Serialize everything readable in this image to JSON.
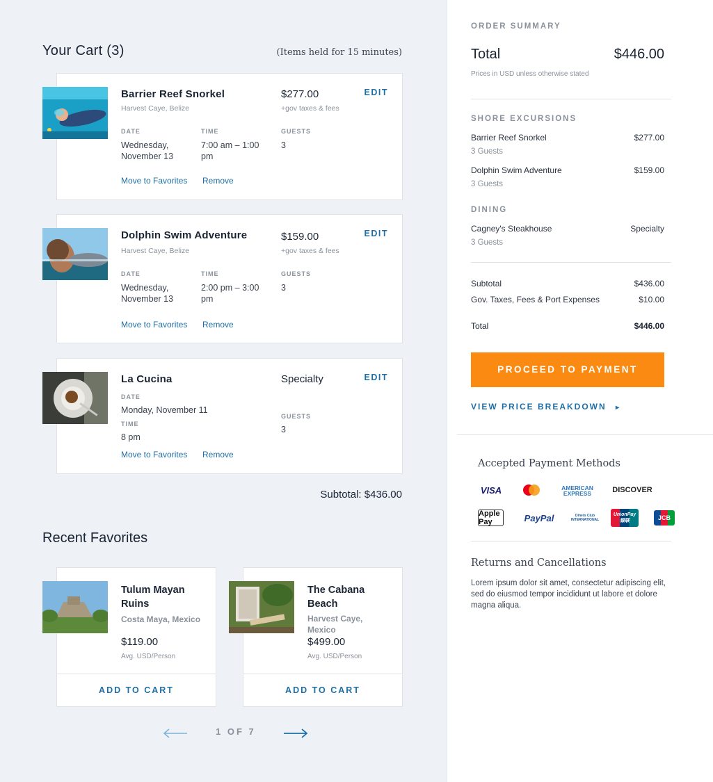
{
  "cart": {
    "title": "Your Cart (3)",
    "held_note": "(Items held for 15 minutes)",
    "edit_label": "EDIT",
    "move_label": "Move to Favorites",
    "remove_label": "Remove",
    "date_label": "DATE",
    "time_label": "TIME",
    "guests_label": "GUESTS",
    "items": [
      {
        "name": "Barrier Reef Snorkel",
        "location": "Harvest Caye, Belize",
        "price": "$277.00",
        "fees": "+gov taxes & fees",
        "date": "Wednesday, November 13",
        "time": "7:00 am – 1:00 pm",
        "guests": "3"
      },
      {
        "name": "Dolphin Swim Adventure",
        "location": "Harvest Caye, Belize",
        "price": "$159.00",
        "fees": "+gov taxes & fees",
        "date": "Wednesday, November 13",
        "time": "2:00 pm – 3:00 pm",
        "guests": "3"
      },
      {
        "name": "La Cucina",
        "price": "Specialty",
        "date": "Monday, November 11",
        "time": "8 pm",
        "guests": "3"
      }
    ],
    "subtotal": "Subtotal: $436.00"
  },
  "favorites": {
    "title": "Recent Favorites",
    "add_label": "ADD TO CART",
    "avg_label": "Avg. USD/Person",
    "items": [
      {
        "name": "Tulum Mayan Ruins",
        "location": "Costa Maya, Mexico",
        "price": "$119.00"
      },
      {
        "name": "The Cabana Beach",
        "location": "Harvest Caye, Mexico",
        "price": "$499.00"
      }
    ],
    "pager": "1 OF 7"
  },
  "summary": {
    "label": "ORDER SUMMARY",
    "total_label": "Total",
    "total_value": "$446.00",
    "note": "Prices in USD unless otherwise stated",
    "shore_label": "SHORE EXCURSIONS",
    "shore": [
      {
        "name": "Barrier Reef Snorkel",
        "value": "$277.00",
        "sub": "3 Guests"
      },
      {
        "name": "Dolphin Swim Adventure",
        "value": "$159.00",
        "sub": "3 Guests"
      }
    ],
    "dining_label": "DINING",
    "dining": [
      {
        "name": "Cagney's Steakhouse",
        "value": "Specialty",
        "sub": "3 Guests"
      }
    ],
    "subtotal_label": "Subtotal",
    "subtotal_value": "$436.00",
    "taxes_label": "Gov. Taxes, Fees & Port Expenses",
    "taxes_value": "$10.00",
    "final_total_label": "Total",
    "final_total_value": "$446.00",
    "proceed_label": "PROCEED TO PAYMENT",
    "breakdown_label": "VIEW PRICE BREAKDOWN",
    "breakdown_arrow": "▸",
    "accepted_label": "Accepted Payment Methods",
    "payments": [
      "VISA",
      "Mastercard",
      "AMERICAN EXPRESS",
      "DISCOVER",
      "Apple Pay",
      "PayPal",
      "Diners Club INTERNATIONAL",
      "UnionPay 银联",
      "JCB"
    ],
    "returns_label": "Returns and Cancellations",
    "returns_body": "Lorem ipsum dolor sit amet, consectetur adipiscing elit, sed do eiusmod tempor incididunt ut labore et dolore magna aliqua."
  },
  "colors": {
    "accent": "#1e6fa6",
    "cta": "#fb8a13",
    "muted": "#8a919b",
    "background": "#eef1f6"
  }
}
